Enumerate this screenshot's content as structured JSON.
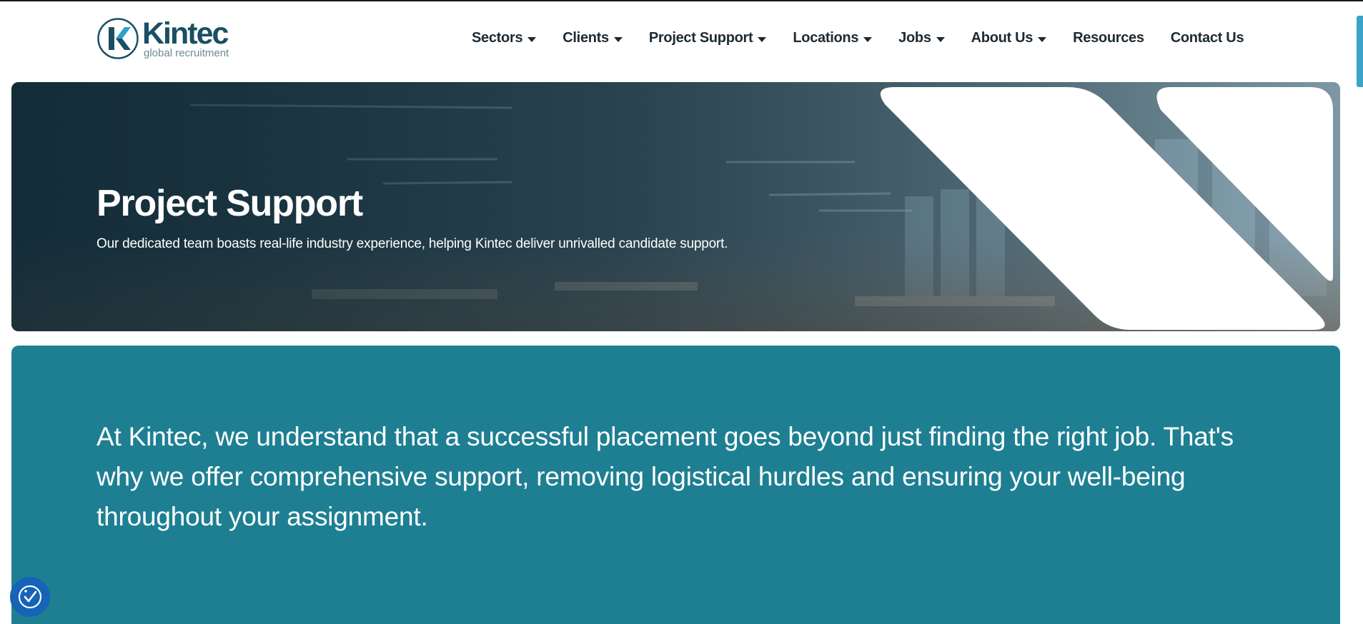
{
  "header": {
    "logo": {
      "name": "Kintec",
      "tagline": "global recruitment"
    },
    "nav": [
      {
        "label": "Sectors",
        "has_dropdown": true
      },
      {
        "label": "Clients",
        "has_dropdown": true
      },
      {
        "label": "Project Support",
        "has_dropdown": true
      },
      {
        "label": "Locations",
        "has_dropdown": true
      },
      {
        "label": "Jobs",
        "has_dropdown": true
      },
      {
        "label": "About Us",
        "has_dropdown": true
      },
      {
        "label": "Resources",
        "has_dropdown": false
      },
      {
        "label": "Contact Us",
        "has_dropdown": false
      }
    ]
  },
  "hero": {
    "title": "Project Support",
    "subtitle": "Our dedicated team boasts real-life industry experience, helping Kintec deliver unrivalled candidate support."
  },
  "intro": {
    "text": "At Kintec, we understand that a successful placement goes beyond just finding the right job. That's why we offer comprehensive support, removing logistical hurdles and ensuring your well-being throughout your assignment."
  },
  "accessibility_button": {
    "icon": "accessibility-icon"
  },
  "colors": {
    "brand_dark": "#1a4f63",
    "brand_accent": "#2aa3c9",
    "teal_panel": "#1e7f92",
    "nav_text": "#1d2a33",
    "accessibility_blue": "#1663b8"
  }
}
